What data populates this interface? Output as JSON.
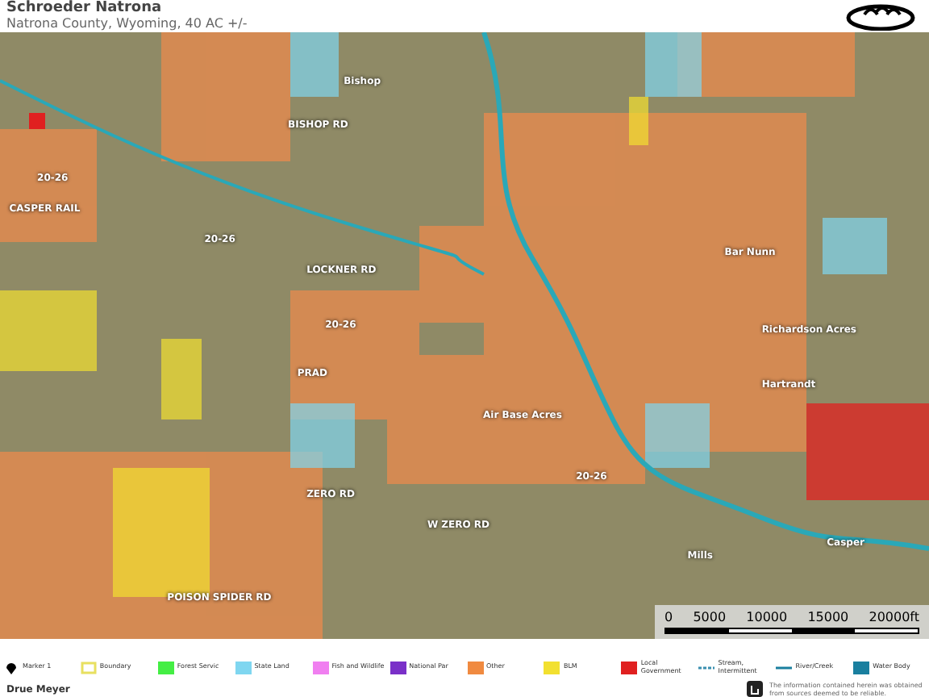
{
  "header": {
    "title": "Schroeder Natrona",
    "subtitle": "Natrona County, Wyoming, 40 AC +/-"
  },
  "map": {
    "labels": [
      "Bishop",
      "BISHOP RD",
      "20-26",
      "CASPER RAIL",
      "20-26",
      "LOCKNER RD",
      "20-26",
      "PRAD",
      "Air Base Acres",
      "Bar Nunn",
      "Richardson Acres",
      "Hartrandt",
      "ZERO RD",
      "W ZERO RD",
      "20-26",
      "POISON SPIDER RD",
      "Casper",
      "Mills"
    ],
    "scale": [
      "0",
      "5000",
      "10000",
      "15000",
      "20000ft"
    ]
  },
  "legend": [
    {
      "kind": "pin",
      "label": "Marker 1",
      "color": "#000000"
    },
    {
      "kind": "outline",
      "label": "Boundary",
      "color": "#e8e060"
    },
    {
      "kind": "fill",
      "label": "Forest Servic",
      "color": "#44ee44"
    },
    {
      "kind": "fill",
      "label": "State Land",
      "color": "#7fd6f0"
    },
    {
      "kind": "fill",
      "label": "Fish and Wildlife",
      "color": "#f07ff0"
    },
    {
      "kind": "fill",
      "label": "National Par",
      "color": "#7a30c8"
    },
    {
      "kind": "fill",
      "label": "Other",
      "color": "#f08a40"
    },
    {
      "kind": "fill",
      "label": "BLM",
      "color": "#f2e030"
    },
    {
      "kind": "fill",
      "label": "Local Government",
      "color": "#e02020"
    },
    {
      "kind": "dashed",
      "label": "Stream, Intermittent",
      "color": "#3a8fb0"
    },
    {
      "kind": "line",
      "label": "River/Creek",
      "color": "#1a7f9f"
    },
    {
      "kind": "fill",
      "label": "Water Body",
      "color": "#1a7f9f"
    }
  ],
  "footer": {
    "agent": "Drue Meyer",
    "disclaimer": "The information contained herein was obtained from sources deemed to be reliable."
  }
}
